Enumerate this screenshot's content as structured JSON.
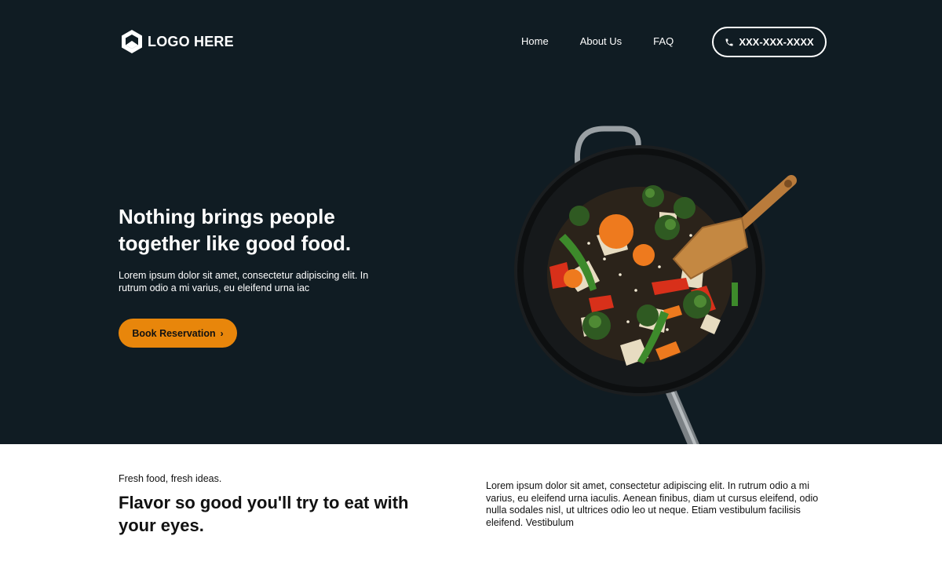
{
  "nav": {
    "logo_text": "LOGO HERE",
    "links": [
      {
        "label": "Home"
      },
      {
        "label": "About Us"
      },
      {
        "label": "FAQ"
      }
    ],
    "phone_label": "XXX-XXX-XXXX"
  },
  "hero": {
    "title": "Nothing brings people together like good food.",
    "subtitle": "Lorem ipsum dolor sit amet, consectetur adipiscing elit. In rutrum odio a mi varius, eu eleifend urna iac",
    "cta_label": "Book Reservation",
    "cta_icon": "chevron-right-icon",
    "background_color": "#101c23",
    "accent_color": "#e8860b"
  },
  "section": {
    "eyebrow": "Fresh food, fresh ideas.",
    "title": "Flavor so good you'll try to eat with your eyes.",
    "body": "Lorem ipsum dolor sit amet, consectetur adipiscing elit. In rutrum odio a mi varius, eu eleifend urna iaculis. Aenean finibus, diam ut cursus eleifend, odio nulla sodales nisl, ut ultrices odio leo ut neque. Etiam vestibulum facilisis eleifend. Vestibulum"
  }
}
